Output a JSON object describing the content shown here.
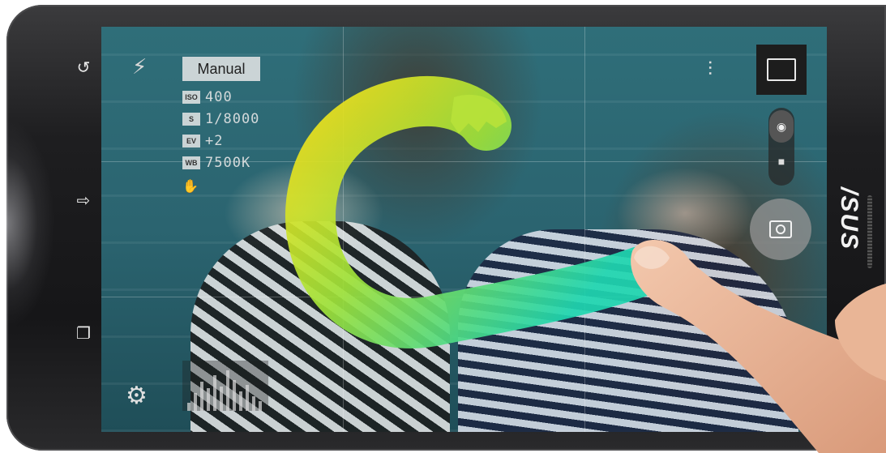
{
  "navbar": {
    "back_icon": "back-arrow-icon",
    "home_icon": "home-icon",
    "recents_icon": "recent-apps-icon"
  },
  "camera": {
    "mode_label": "Manual",
    "params": [
      {
        "key": "ISO",
        "value": "400"
      },
      {
        "key": "S",
        "value": "1/8000"
      },
      {
        "key": "EV",
        "value": "+2"
      },
      {
        "key": "WB",
        "value": "7500K"
      }
    ]
  },
  "brand": {
    "logo_text": "/SUS"
  },
  "colors": {
    "gesture_start": "#f5e21a",
    "gesture_mid": "#9fe23a",
    "gesture_end": "#1fd6b0",
    "screen_tint": "#2f6e79"
  }
}
